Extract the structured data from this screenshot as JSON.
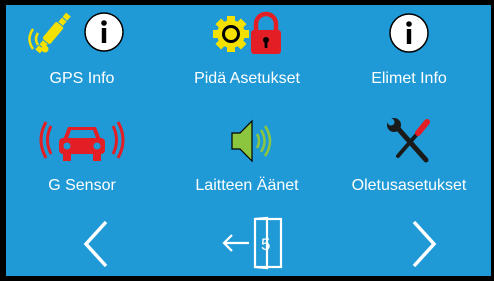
{
  "menu": {
    "items": [
      {
        "label": "GPS Info",
        "icons": [
          "satellite-icon",
          "info-icon"
        ]
      },
      {
        "label": "Pidä Asetukset",
        "icons": [
          "gear-icon",
          "lock-icon"
        ]
      },
      {
        "label": "Elimet Info",
        "icons": [
          "info-icon"
        ]
      },
      {
        "label": "G Sensor",
        "icons": [
          "car-vibration-icon"
        ]
      },
      {
        "label": "Laitteen Äänet",
        "icons": [
          "speaker-icon"
        ]
      },
      {
        "label": "Oletusasetukset",
        "icons": [
          "tools-icon"
        ]
      }
    ]
  },
  "navigation": {
    "prev_icon": "chevron-left-icon",
    "exit_icon": "exit-door-icon",
    "exit_number": "5",
    "next_icon": "chevron-right-icon"
  },
  "colors": {
    "background": "#1f9ad6",
    "accent_yellow": "#f5e100",
    "accent_red": "#e41e25",
    "accent_green": "#8cc63e"
  }
}
